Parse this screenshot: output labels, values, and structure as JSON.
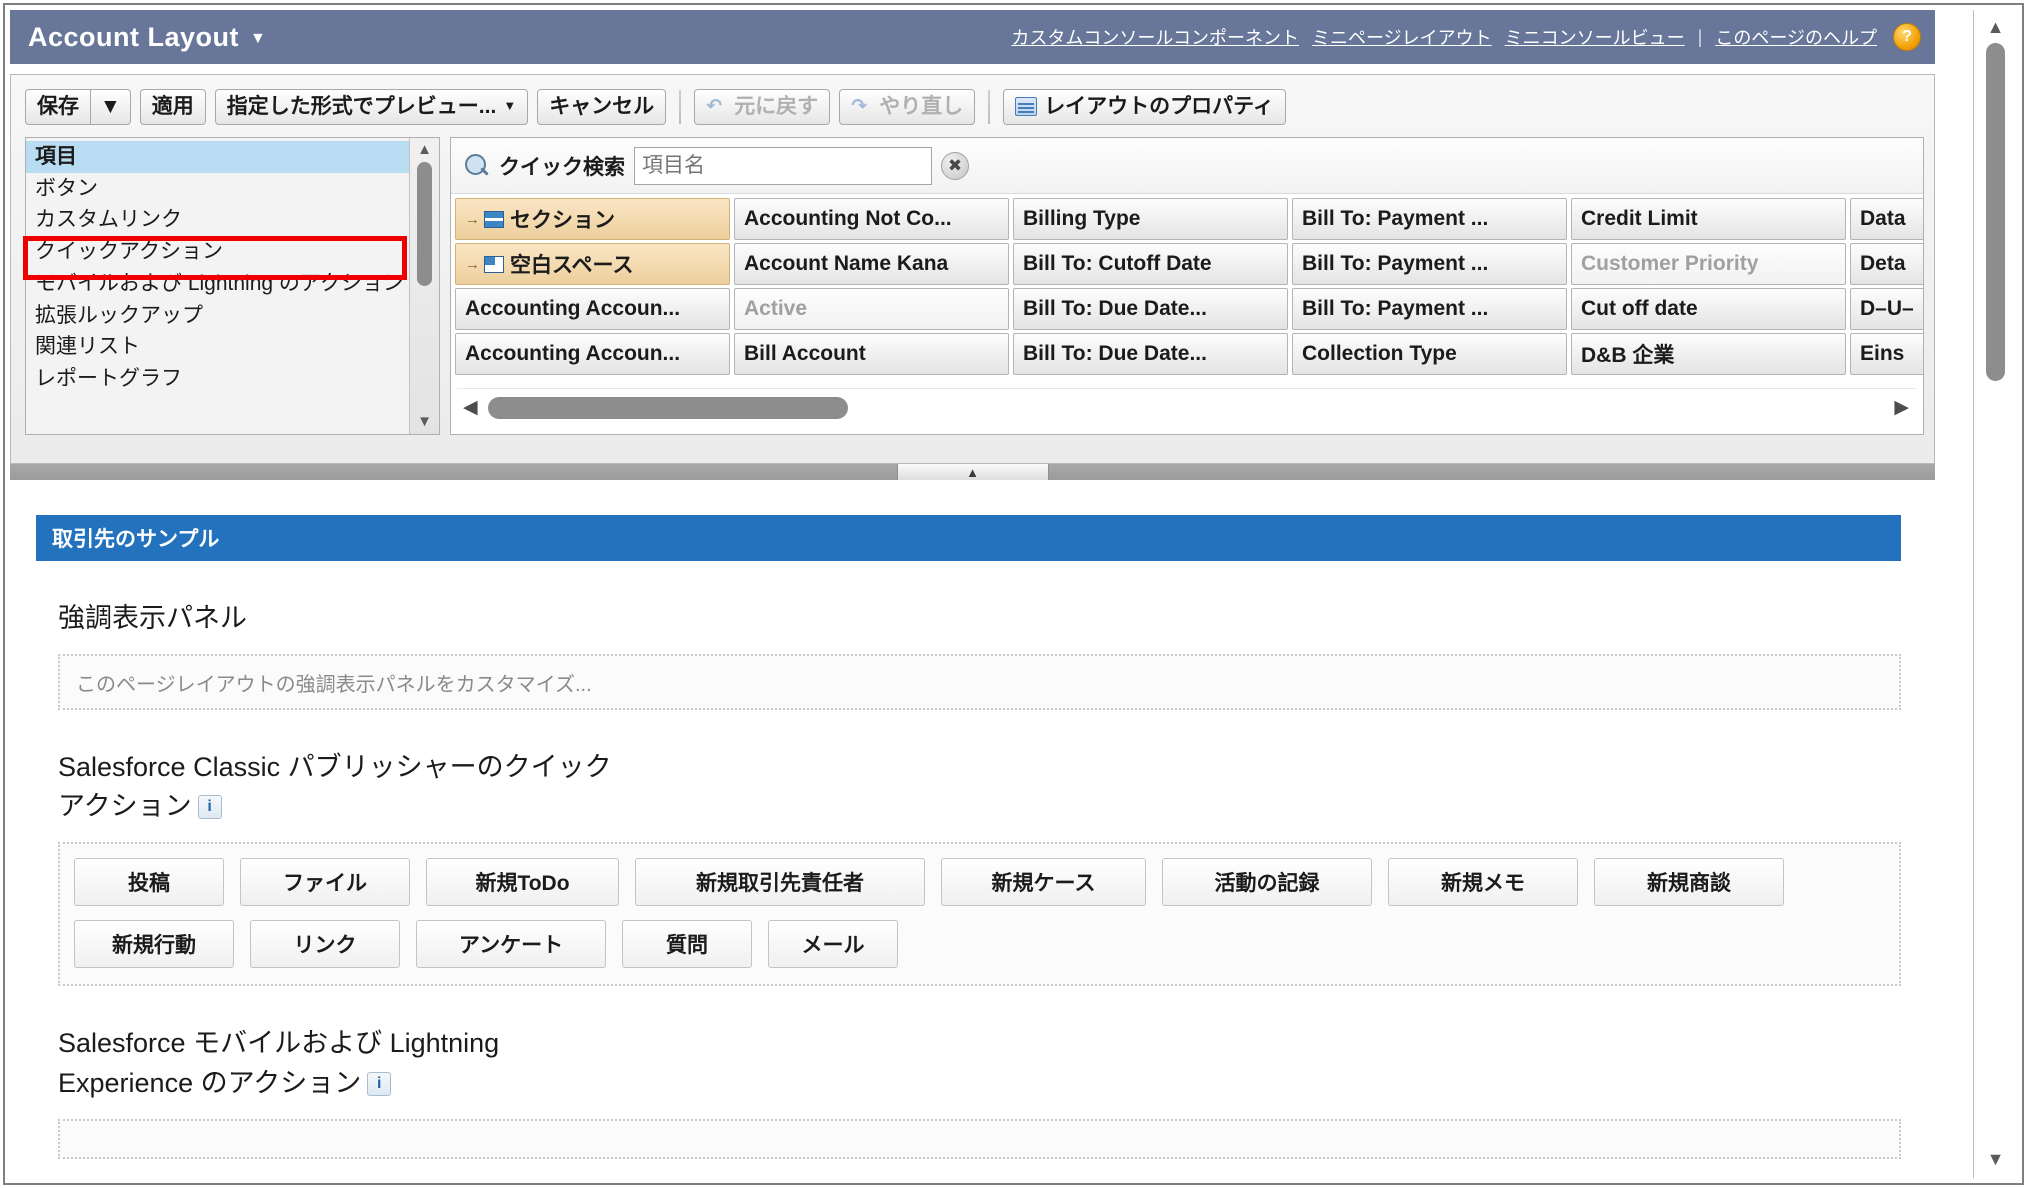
{
  "header": {
    "title": "Account Layout",
    "caret": "▼",
    "links": [
      "カスタムコンソールコンポーネント",
      "ミニページレイアウト",
      "ミニコンソールビュー"
    ],
    "separator": "|",
    "help_link": "このページのヘルプ",
    "help_badge": "?",
    "bg_color": "#677699"
  },
  "toolbar": {
    "save_label": "保存",
    "save_caret": "▼",
    "apply_label": "適用",
    "preview_label": "指定した形式でプレビュー...",
    "preview_caret": "▼",
    "cancel_label": "キャンセル",
    "undo_label": "元に戻す",
    "redo_label": "やり直し",
    "layout_properties_label": "レイアウトのプロパティ"
  },
  "sidebar": {
    "items": [
      {
        "label": "項目",
        "selected": true
      },
      {
        "label": "ボタン",
        "selected": false
      },
      {
        "label": "カスタムリンク",
        "selected": false
      },
      {
        "label": "クイックアクション",
        "selected": false
      },
      {
        "label": "モバイルおよび Lightning のアクション",
        "selected": false,
        "highlighted": true
      },
      {
        "label": "拡張ルックアップ",
        "selected": false
      },
      {
        "label": "関連リスト",
        "selected": false
      },
      {
        "label": "レポートグラフ",
        "selected": false
      }
    ],
    "scroll_up": "▲",
    "scroll_down": "▼",
    "highlight_color": "#ee0000"
  },
  "quick_search": {
    "label": "クイック検索",
    "placeholder": "項目名",
    "value": "",
    "clear_label": "✖"
  },
  "palette": {
    "rows": [
      [
        {
          "label": "セクション",
          "kind": "section"
        },
        {
          "label": "Accounting Not Co...",
          "kind": "field"
        },
        {
          "label": "Billing Type",
          "kind": "field"
        },
        {
          "label": "Bill To: Payment ...",
          "kind": "field"
        },
        {
          "label": "Credit Limit",
          "kind": "field"
        },
        {
          "label": "Data",
          "kind": "field"
        }
      ],
      [
        {
          "label": "空白スペース",
          "kind": "blank"
        },
        {
          "label": "Account Name Kana",
          "kind": "field"
        },
        {
          "label": "Bill To: Cutoff Date",
          "kind": "field"
        },
        {
          "label": "Bill To: Payment ...",
          "kind": "field"
        },
        {
          "label": "Customer Priority",
          "kind": "field-dim"
        },
        {
          "label": "Deta",
          "kind": "field"
        }
      ],
      [
        {
          "label": "Accounting Accoun...",
          "kind": "field"
        },
        {
          "label": "Active",
          "kind": "field-dim"
        },
        {
          "label": "Bill To: Due Date...",
          "kind": "field"
        },
        {
          "label": "Bill To: Payment ...",
          "kind": "field"
        },
        {
          "label": "Cut off date",
          "kind": "field"
        },
        {
          "label": "D–U–",
          "kind": "field"
        }
      ],
      [
        {
          "label": "Accounting Accoun...",
          "kind": "field"
        },
        {
          "label": "Bill Account",
          "kind": "field"
        },
        {
          "label": "Bill To: Due Date...",
          "kind": "field"
        },
        {
          "label": "Collection Type",
          "kind": "field"
        },
        {
          "label": "D&B 企業",
          "kind": "field"
        },
        {
          "label": "Eins",
          "kind": "field"
        }
      ]
    ],
    "hscroll_left": "◀",
    "hscroll_right": "▶"
  },
  "splitter": {
    "handle": "▲"
  },
  "preview": {
    "section_bar_title": "取引先のサンプル",
    "highlights": {
      "heading": "強調表示パネル",
      "placeholder": "このページレイアウトの強調表示パネルをカスタマイズ..."
    },
    "classic_publisher": {
      "heading_line1": "Salesforce Classic パブリッシャーのクイック",
      "heading_line2": "アクション",
      "info_badge": "i",
      "rows": [
        [
          "投稿",
          "ファイル",
          "新規ToDo",
          "新規取引先責任者",
          "新規ケース",
          "活動の記録",
          "新規メモ",
          "新規商談"
        ],
        [
          "新規行動",
          "リンク",
          "アンケート",
          "質問",
          "メール"
        ]
      ]
    },
    "mobile_lightning": {
      "heading_line1": "Salesforce モバイルおよび Lightning",
      "heading_line2": "Experience のアクション",
      "info_badge": "i"
    }
  },
  "page_scroll": {
    "up": "▲",
    "down": "▼"
  },
  "colors": {
    "header_bg": "#677699",
    "section_bar": "#2272bd",
    "highlight_red": "#ee0000",
    "selected_row": "#b8ddf2",
    "special_item": "#eccf9d"
  }
}
